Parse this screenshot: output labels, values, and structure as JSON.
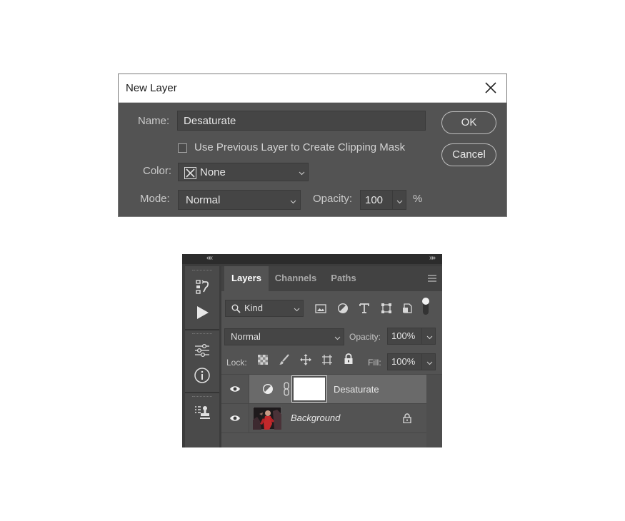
{
  "dialog": {
    "title": "New Layer",
    "name_label": "Name:",
    "name_value": "Desaturate",
    "clip_label": "Use Previous Layer to Create Clipping Mask",
    "clip_checked": false,
    "color_label": "Color:",
    "color_value": "None",
    "mode_label": "Mode:",
    "mode_value": "Normal",
    "opacity_label": "Opacity:",
    "opacity_value": "100",
    "opacity_unit": "%",
    "ok_label": "OK",
    "cancel_label": "Cancel"
  },
  "panel": {
    "collapse_left": "««",
    "collapse_right": "»»",
    "tabs": [
      {
        "label": "Layers",
        "active": true
      },
      {
        "label": "Channels",
        "active": false
      },
      {
        "label": "Paths",
        "active": false
      }
    ],
    "filter_label": "Kind",
    "blend_mode": "Normal",
    "opacity_label": "Opacity:",
    "opacity_value": "100%",
    "lock_label": "Lock:",
    "fill_label": "Fill:",
    "fill_value": "100%",
    "layers": [
      {
        "name": "Desaturate",
        "type": "adjustment",
        "visible": true,
        "selected": true
      },
      {
        "name": "Background",
        "type": "image",
        "visible": true,
        "locked": true
      }
    ]
  },
  "colors": {
    "dialog_bg": "#535353",
    "panel_bg": "#535353",
    "selected_row": "#6a6a6a"
  }
}
